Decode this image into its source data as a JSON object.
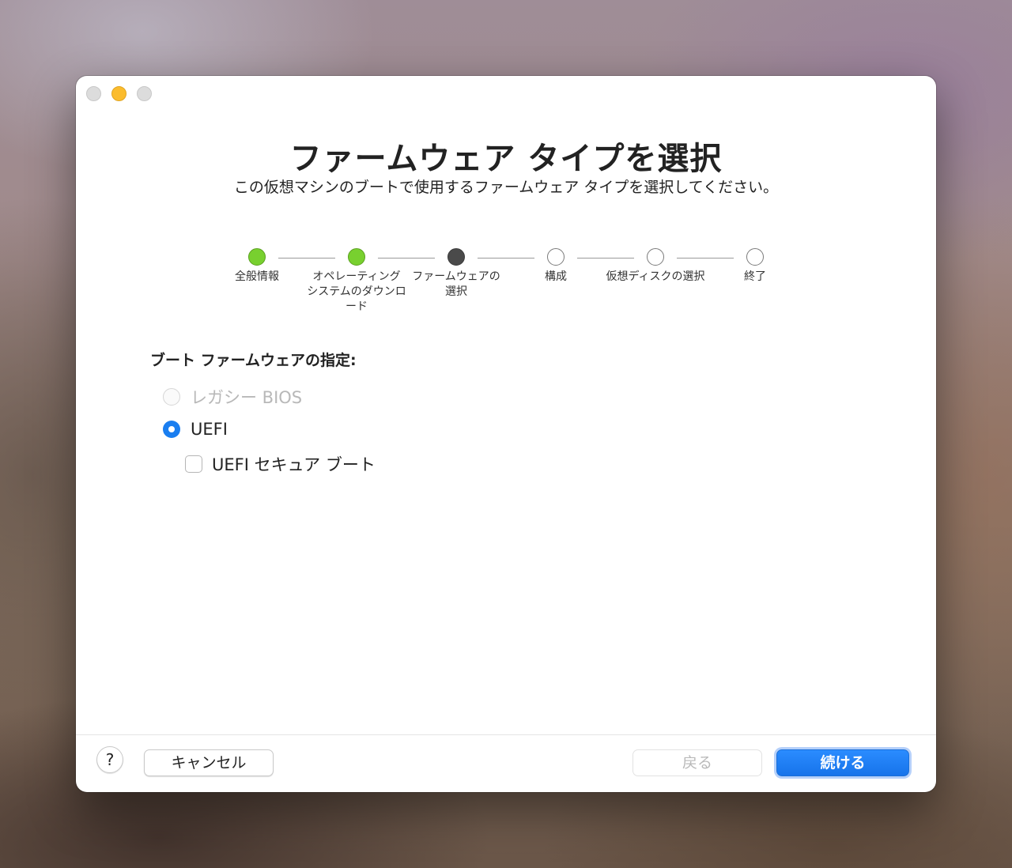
{
  "window": {
    "title": "ファームウェア タイプを選択",
    "subtitle": "この仮想マシンのブートで使用するファームウェア タイプを選択してください。"
  },
  "steps": [
    {
      "label": "全般情報",
      "state": "done"
    },
    {
      "label": "オペレーティング\nシステムのダウンロ\nード",
      "state": "done"
    },
    {
      "label": "ファームウェアの\n選択",
      "state": "current"
    },
    {
      "label": "構成",
      "state": "todo"
    },
    {
      "label": "仮想ディスクの選択",
      "state": "todo"
    },
    {
      "label": "終了",
      "state": "todo"
    }
  ],
  "firmware": {
    "section_label": "ブート ファームウェアの指定:",
    "legacy_bios": {
      "label": "レガシー BIOS",
      "selected": false,
      "enabled": false
    },
    "uefi": {
      "label": "UEFI",
      "selected": true,
      "enabled": true
    },
    "secure_boot": {
      "label": "UEFI セキュア ブート",
      "checked": false
    }
  },
  "footer": {
    "help_label": "?",
    "cancel_label": "キャンセル",
    "back_label": "戻る",
    "continue_label": "続ける"
  },
  "colors": {
    "accent": "#1a7ef0",
    "step_done": "#78d02f",
    "step_current": "#4a4a4a",
    "minimize": "#fbbc2d"
  }
}
